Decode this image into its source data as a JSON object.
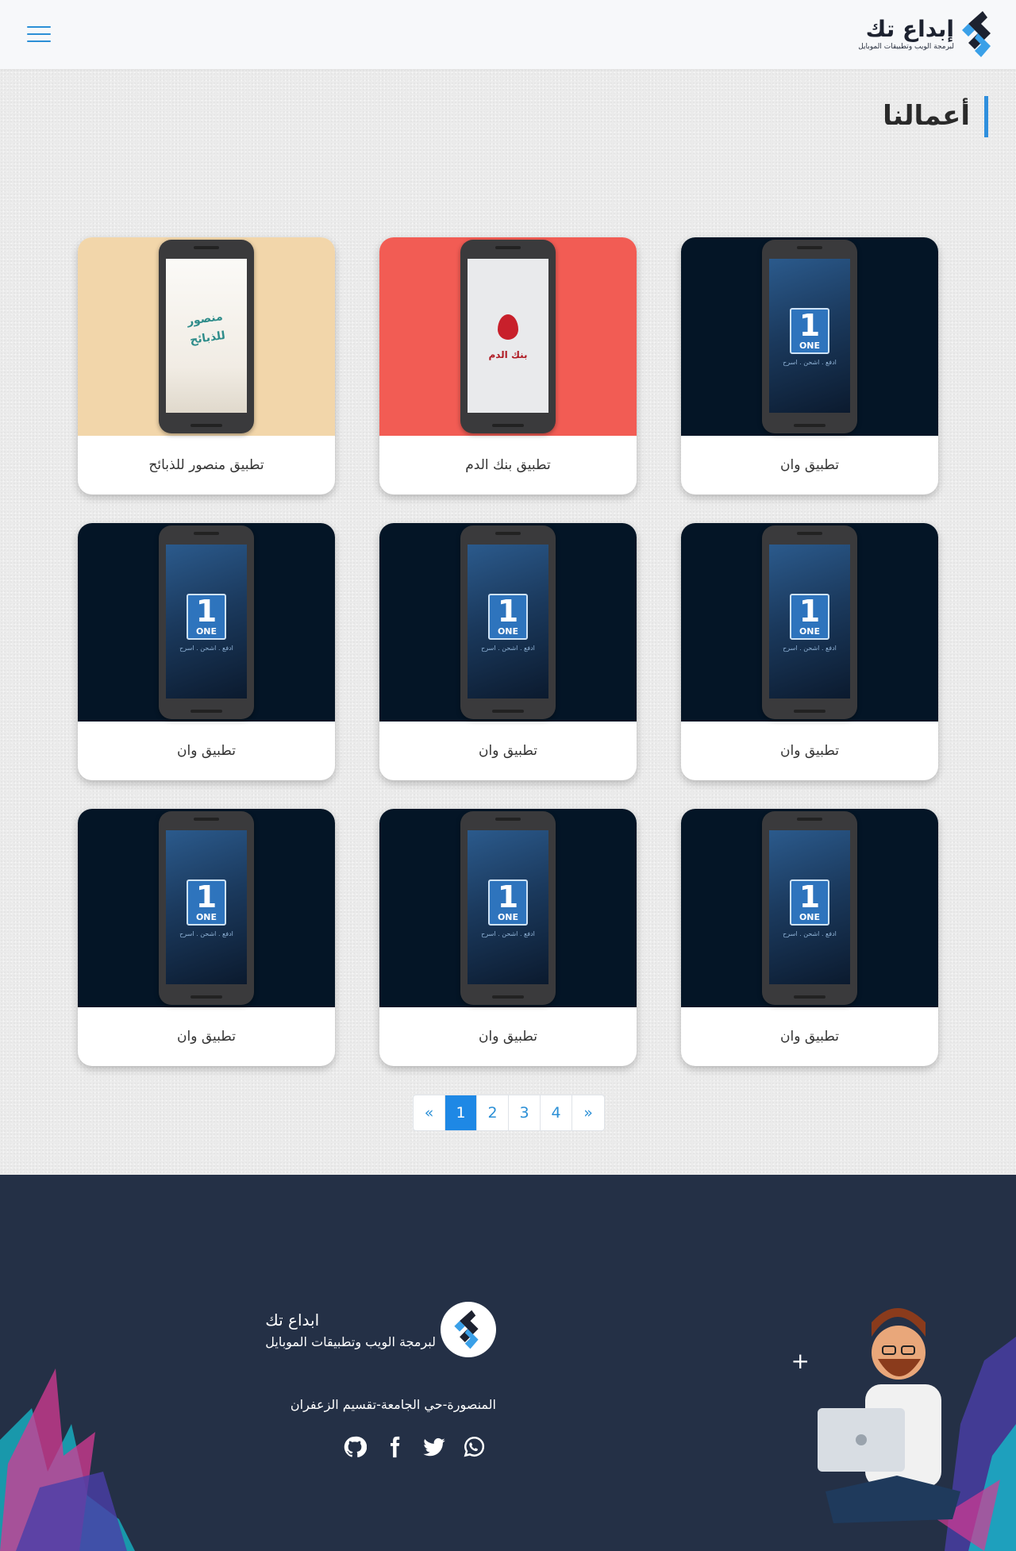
{
  "header": {
    "brand_name": "إبداع تك",
    "brand_tagline": "لبرمجة الويب وتطبيقات الموبايل",
    "menu_icon": "hamburger-icon"
  },
  "main": {
    "page_title": "أعمالنا",
    "projects": [
      {
        "title": "تطبيق وان",
        "bg": "#041526",
        "screen": "one"
      },
      {
        "title": "تطبيق بنك الدم",
        "bg": "#f25c54",
        "screen": "blood"
      },
      {
        "title": "تطبيق منصور للذبائح",
        "bg": "#f2d6aa",
        "screen": "mansour"
      },
      {
        "title": "تطبيق وان",
        "bg": "#041526",
        "screen": "one"
      },
      {
        "title": "تطبيق وان",
        "bg": "#041526",
        "screen": "one"
      },
      {
        "title": "تطبيق وان",
        "bg": "#041526",
        "screen": "one"
      },
      {
        "title": "تطبيق وان",
        "bg": "#041526",
        "screen": "one"
      },
      {
        "title": "تطبيق وان",
        "bg": "#041526",
        "screen": "one"
      },
      {
        "title": "تطبيق وان",
        "bg": "#041526",
        "screen": "one"
      }
    ],
    "screen_text": {
      "one_number": "1",
      "one_word": "ONE",
      "one_sub": "ادفع . اشحن . اسرح",
      "blood_label": "بنك الدم",
      "mansour_label": "منصور للذبائح"
    }
  },
  "pagination": {
    "prev": "«",
    "pages": [
      "1",
      "2",
      "3",
      "4"
    ],
    "current": "1",
    "next": "»"
  },
  "footer": {
    "company_name": "ابداع تك",
    "company_tagline": "لبرمجة الويب وتطبيقات الموبايل",
    "address": "المنصورة-حي الجامعة-تقسيم الزعفران",
    "social": [
      "whatsapp-icon",
      "twitter-icon",
      "facebook-icon",
      "github-icon"
    ]
  },
  "colors": {
    "accent": "#2b8fd6",
    "pager_active": "#1e88e5",
    "footer_bg": "#243046",
    "header_bg": "#f7f8fa"
  }
}
